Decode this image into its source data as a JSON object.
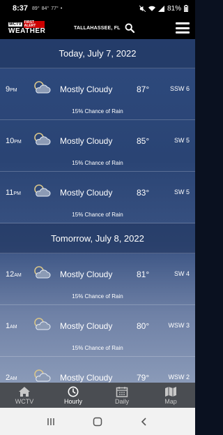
{
  "status": {
    "time": "8:37",
    "notif_icons": [
      "89°",
      "84°",
      "77°",
      "•"
    ],
    "battery": "81%"
  },
  "header": {
    "logo_channel": "WCTV",
    "logo_first_alert": "FIRST ALERT",
    "logo_weather": "WEATHER",
    "location": "TALLAHASSEE, FL"
  },
  "days": [
    {
      "label": "Today, July 7, 2022",
      "hours": [
        {
          "hour": "9",
          "ampm": "PM",
          "condition": "Mostly Cloudy",
          "temp": "87°",
          "wind": "SSW 6",
          "rain": "15% Chance of Rain"
        },
        {
          "hour": "10",
          "ampm": "PM",
          "condition": "Mostly Cloudy",
          "temp": "85°",
          "wind": "SW 5",
          "rain": "15% Chance of Rain"
        },
        {
          "hour": "11",
          "ampm": "PM",
          "condition": "Mostly Cloudy",
          "temp": "83°",
          "wind": "SW 5",
          "rain": "15% Chance of Rain"
        }
      ]
    },
    {
      "label": "Tomorrow, July 8, 2022",
      "hours": [
        {
          "hour": "12",
          "ampm": "AM",
          "condition": "Mostly Cloudy",
          "temp": "81°",
          "wind": "SW 4",
          "rain": "15% Chance of Rain"
        },
        {
          "hour": "1",
          "ampm": "AM",
          "condition": "Mostly Cloudy",
          "temp": "80°",
          "wind": "WSW 3",
          "rain": "15% Chance of Rain"
        },
        {
          "hour": "2",
          "ampm": "AM",
          "condition": "Mostly Cloudy",
          "temp": "79°",
          "wind": "WSW 2",
          "rain": ""
        }
      ]
    }
  ],
  "nav": {
    "items": [
      {
        "label": "WCTV",
        "icon": "home-icon"
      },
      {
        "label": "Hourly",
        "icon": "clock-icon",
        "active": true
      },
      {
        "label": "Daily",
        "icon": "calendar-icon"
      },
      {
        "label": "Map",
        "icon": "map-icon"
      }
    ]
  },
  "colors": {
    "header_bg": "#000000",
    "nav_bg": "#4a4d52",
    "content_top": "#2e4a7e"
  }
}
